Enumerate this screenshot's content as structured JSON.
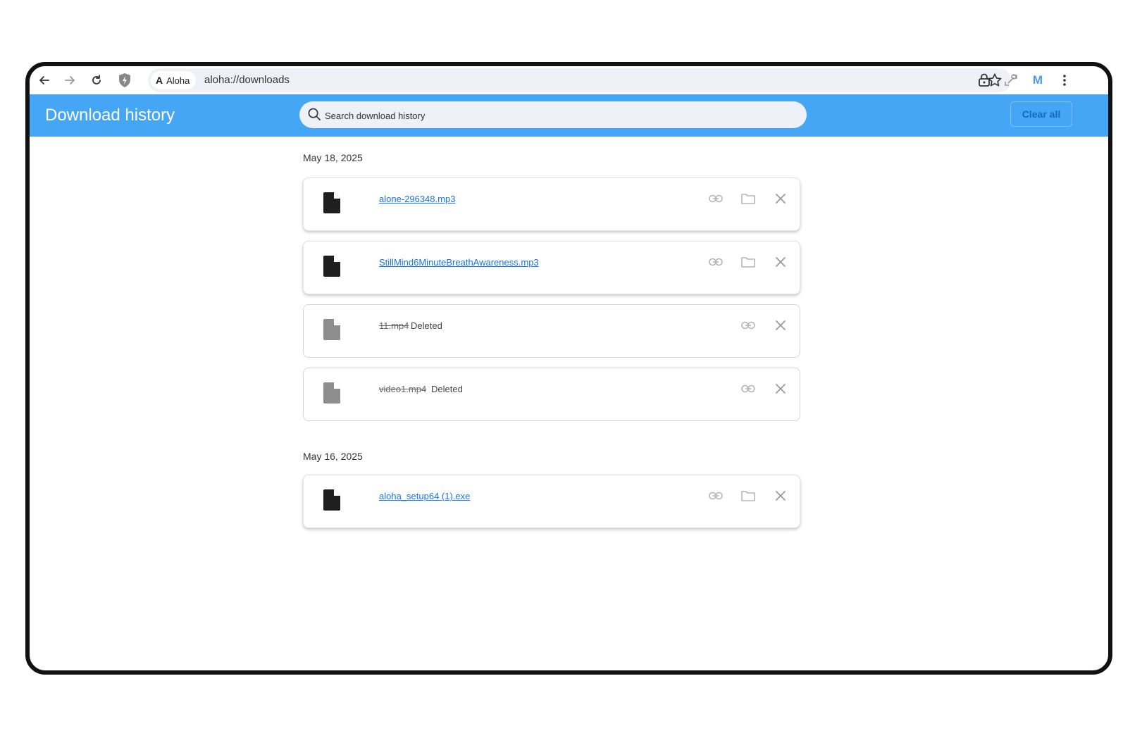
{
  "browser": {
    "site_chip": "Aloha",
    "url": "aloha://downloads",
    "avatar_letter": "M"
  },
  "header": {
    "title": "Download history",
    "search_placeholder": "Search download history",
    "clear_all_label": "Clear all"
  },
  "groups": [
    {
      "date": "May 18, 2025",
      "items": [
        {
          "filename": "alone-296348.mp3",
          "status": ""
        },
        {
          "filename": "StillMind6MinuteBreathAwareness.mp3",
          "status": ""
        },
        {
          "filename": "11.mp4",
          "status": "Deleted"
        },
        {
          "filename": "video1.mp4",
          "status": "Deleted"
        }
      ]
    },
    {
      "date": "May 16, 2025",
      "items": [
        {
          "filename": "aloha_setup64 (1).exe",
          "status": ""
        }
      ]
    }
  ],
  "colors": {
    "header_bg": "#45a6f6",
    "link": "#1a73e8"
  }
}
